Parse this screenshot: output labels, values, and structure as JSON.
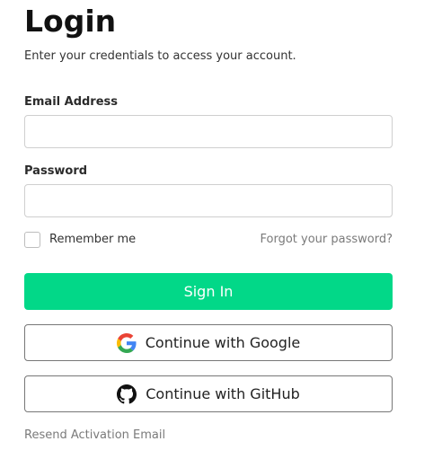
{
  "header": {
    "title": "Login",
    "subtitle": "Enter your credentials to access your account."
  },
  "form": {
    "email": {
      "label": "Email Address",
      "value": "",
      "placeholder": ""
    },
    "password": {
      "label": "Password",
      "value": "",
      "placeholder": ""
    },
    "remember_me": {
      "label": "Remember me",
      "checked": false
    },
    "forgot_password_label": "Forgot your password?",
    "sign_in_label": "Sign In",
    "google_label": "Continue with Google",
    "github_label": "Continue with GitHub",
    "resend_activation_label": "Resend Activation Email"
  },
  "icons": {
    "google": "google-logo-icon",
    "github": "github-logo-icon"
  },
  "colors": {
    "primary": "#02d888",
    "link": "#7a7a7a",
    "input_border": "#cfcfcf",
    "oauth_border": "#777777"
  }
}
